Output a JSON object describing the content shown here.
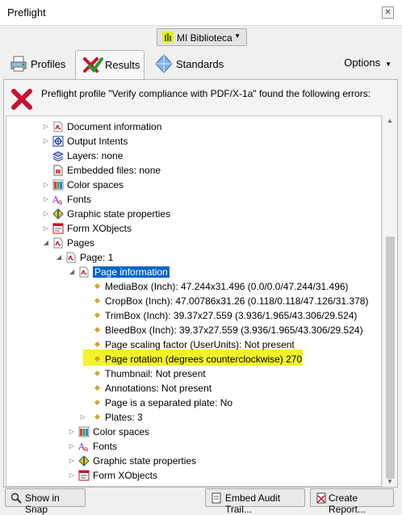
{
  "window": {
    "title": "Preflight",
    "close_glyph": "✕"
  },
  "library": {
    "label": "MI Biblioteca",
    "icon": "library-icon"
  },
  "tabs": [
    {
      "label": "Profiles",
      "icon": "profiles-icon",
      "active": false
    },
    {
      "label": "Results",
      "icon": "results-icon",
      "active": true
    },
    {
      "label": "Standards",
      "icon": "standards-icon",
      "active": false
    }
  ],
  "options": {
    "label": "Options"
  },
  "results": {
    "message": "Preflight profile \"Verify compliance with PDF/X-1a\" found the following errors:",
    "error_icon": "error-x-icon"
  },
  "tree": [
    {
      "text": "Document information",
      "expander": "collapsed",
      "icon": "pdf-icon"
    },
    {
      "text": "Output Intents",
      "expander": "collapsed",
      "icon": "output-intents-icon"
    },
    {
      "text": "Layers: none",
      "expander": "none",
      "icon": "layers-icon"
    },
    {
      "text": "Embedded files: none",
      "expander": "none",
      "icon": "embedded-files-icon"
    },
    {
      "text": "Color spaces",
      "expander": "collapsed",
      "icon": "color-spaces-icon"
    },
    {
      "text": "Fonts",
      "expander": "collapsed",
      "icon": "fonts-icon"
    },
    {
      "text": "Graphic state properties",
      "expander": "collapsed",
      "icon": "graphic-state-icon"
    },
    {
      "text": "Form XObjects",
      "expander": "collapsed",
      "icon": "form-xobjects-icon"
    },
    {
      "text": "Pages",
      "expander": "expanded",
      "icon": "pdf-icon"
    },
    {
      "text": "Page: 1",
      "expander": "expanded",
      "icon": "pdf-icon"
    },
    {
      "text": "Page information",
      "expander": "expanded",
      "icon": "pdf-icon",
      "selected": true
    },
    {
      "text": "MediaBox (Inch): 47.244x31.496 (0.0/0.0/47.244/31.496)",
      "expander": "none",
      "icon": "bullet-icon"
    },
    {
      "text": "CropBox (Inch): 47.00786x31.26 (0.118/0.118/47.126/31.378)",
      "expander": "none",
      "icon": "bullet-icon"
    },
    {
      "text": "TrimBox (Inch): 39.37x27.559 (3.936/1.965/43.306/29.524)",
      "expander": "none",
      "icon": "bullet-icon"
    },
    {
      "text": "BleedBox (Inch): 39.37x27.559 (3.936/1.965/43.306/29.524)",
      "expander": "none",
      "icon": "bullet-icon"
    },
    {
      "text": "Page scaling factor (UserUnits): Not present",
      "expander": "none",
      "icon": "bullet-icon"
    },
    {
      "text": "Page rotation (degrees counterclockwise) 270",
      "expander": "none",
      "icon": "bullet-icon",
      "highlighted": true
    },
    {
      "text": "Thumbnail: Not present",
      "expander": "none",
      "icon": "bullet-icon"
    },
    {
      "text": "Annotations: Not present",
      "expander": "none",
      "icon": "bullet-icon"
    },
    {
      "text": "Page is a separated plate: No",
      "expander": "none",
      "icon": "bullet-icon"
    },
    {
      "text": "Plates: 3",
      "expander": "collapsed",
      "icon": "bullet-icon"
    },
    {
      "text": "Color spaces",
      "expander": "collapsed",
      "icon": "color-spaces-icon"
    },
    {
      "text": "Fonts",
      "expander": "collapsed",
      "icon": "fonts-icon"
    },
    {
      "text": "Graphic state properties",
      "expander": "collapsed",
      "icon": "graphic-state-icon"
    },
    {
      "text": "Form XObjects",
      "expander": "collapsed",
      "icon": "form-xobjects-icon"
    }
  ],
  "buttons": {
    "show_in_snap": "Show in Snap",
    "embed_audit": "Embed Audit Trail...",
    "create_report": "Create Report..."
  },
  "colors": {
    "selection": "#0a64c8",
    "highlight": "#f2f22a",
    "error": "#c8102e"
  }
}
